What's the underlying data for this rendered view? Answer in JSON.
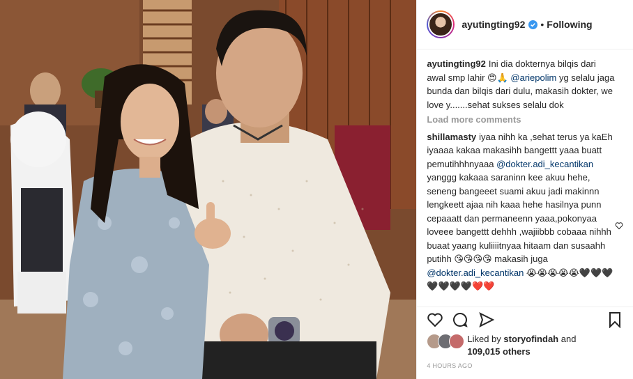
{
  "post": {
    "username": "ayutingting92",
    "follow_label": "Following",
    "separator": "•",
    "caption": {
      "username": "ayutingting92",
      "text_before": "Ini dia dokternya bilqis dari awal smp lahir 😍🙏 ",
      "mention": "@ariepolim",
      "text_after": " yg selalu jaga bunda dan bilqis dari dulu, makasih dokter, we love y.......sehat sukses selalu dok"
    },
    "load_more_label": "Load more comments",
    "comment": {
      "username": "shillamasty",
      "text1": "iyaa nihh ka ,sehat terus ya kaEh iyaaaa kakaa makasihh bangettt yaaa buatt pemutihhhnyaaa ",
      "mention1": "@dokter.adi_kecantikan",
      "text2": " yanggg kakaaa saraninn kee akuu hehe, seneng bangeeet suami akuu jadi makinnn lengkeett ajaa nih kaaa hehe hasilnya punn cepaaatt dan permaneenn yaaa,pokonyaa loveee bangettt dehhh ,wajiibbb cobaaa nihhh buaat yaang kuliiiitnyaa hitaam dan susaahh putihh 😘😘😘😘 makasih juga ",
      "mention2": "@dokter.adi_kecantikan",
      "text3": " 😭😭😭😭😭🖤🖤🖤🖤🖤🖤🖤❤️❤️"
    },
    "likes": {
      "prefix": "Liked by ",
      "user": "storyofindah",
      "middle": " and ",
      "count": "109,015 others"
    },
    "time_ago": "4 HOURS AGO"
  },
  "icons": {
    "verified": "verified-badge-icon",
    "heart": "heart-icon",
    "comment": "comment-icon",
    "share": "share-icon",
    "save": "bookmark-icon"
  },
  "colors": {
    "verified": "#3897f0",
    "mention": "#003569",
    "muted": "#999999"
  }
}
